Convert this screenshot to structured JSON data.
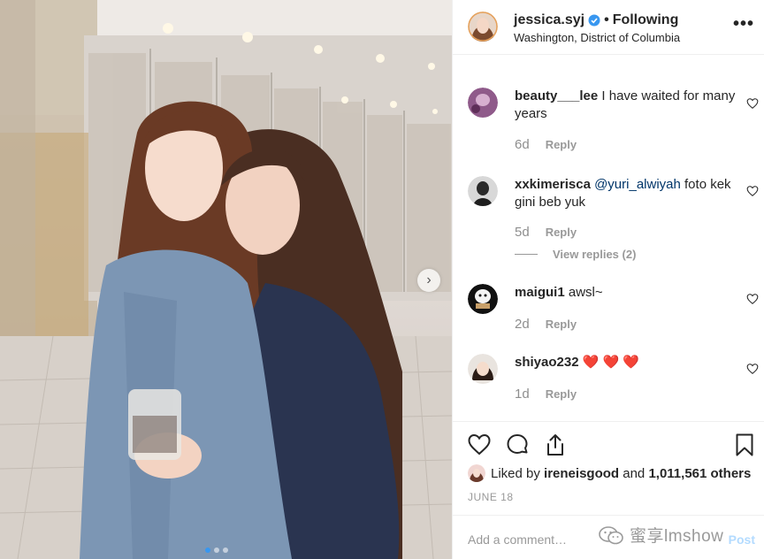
{
  "post": {
    "username": "jessica.syj",
    "separator": "•",
    "follow_state": "Following",
    "location": "Washington, District of Columbia",
    "more_label": "•••",
    "next_label": "›"
  },
  "comments": [
    {
      "user": "beauty___lee",
      "mention": "",
      "text": "I have waited for many years",
      "time": "6d",
      "reply": "Reply"
    },
    {
      "user": "xxkimerisca",
      "mention": "@yuri_alwiyah",
      "text": "foto kek gini beb yuk",
      "time": "5d",
      "reply": "Reply"
    },
    {
      "user": "maigui1",
      "mention": "",
      "text": "awsl~",
      "time": "2d",
      "reply": "Reply"
    },
    {
      "user": "shiyao232",
      "mention": "",
      "text": "❤️ ❤️ ❤️",
      "time": "1d",
      "reply": "Reply"
    }
  ],
  "view_replies": "View replies (2)",
  "likes": {
    "prefix": "Liked by",
    "user": "ireneisgood",
    "conjunction": "and",
    "count": "1,011,561 others"
  },
  "date": "JUNE 18",
  "add_comment": {
    "placeholder": "Add a comment…",
    "post_label": "Post"
  },
  "watermark": "蜜享lmshow",
  "carousel": {
    "total": 3,
    "active": 0
  },
  "icons": {
    "like": "heart-icon",
    "comment": "comment-icon",
    "share": "share-icon",
    "save": "bookmark-icon",
    "verified": "verified-badge-icon"
  },
  "colors": {
    "link": "#003569",
    "verified": "#3897f0",
    "post_disabled": "#b3dbff",
    "muted": "#999999"
  }
}
